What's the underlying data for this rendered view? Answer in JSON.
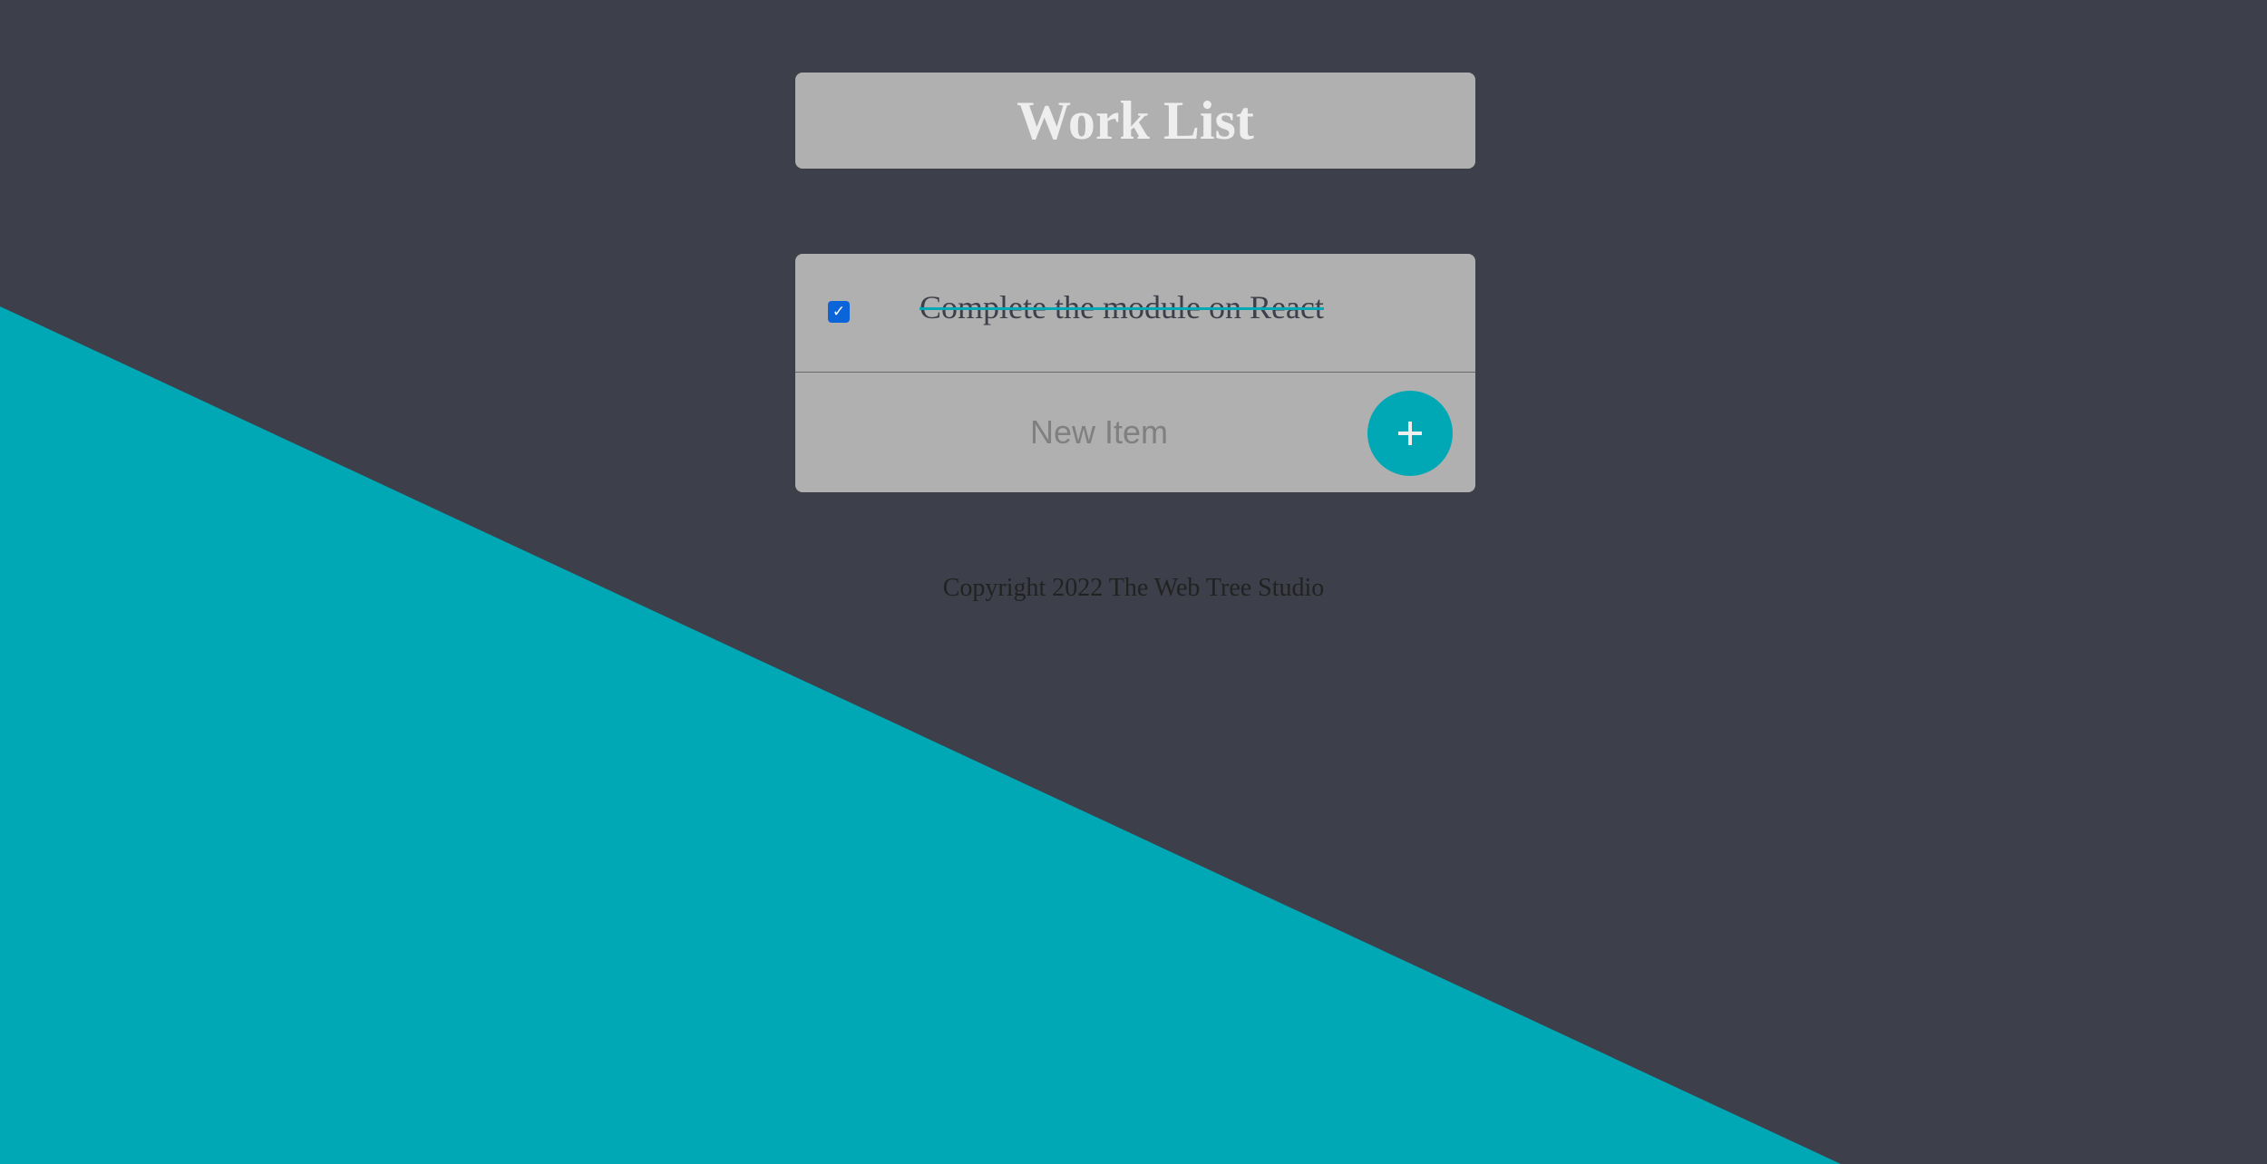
{
  "header": {
    "title": "Work List"
  },
  "todo": {
    "items": [
      {
        "text": "Complete the module on React",
        "checked": true
      }
    ],
    "new_item": {
      "placeholder": "New Item",
      "value": ""
    },
    "add_button_label": "+"
  },
  "footer": {
    "copyright": "Copyright 2022 The Web Tree Studio"
  },
  "colors": {
    "background": "#3d404a",
    "accent": "#00a8b5",
    "card": "#b0b0b0",
    "checkbox": "#0b65d8",
    "heading_text": "#eeeeee"
  },
  "icons": {
    "add": "plus-icon",
    "checked": "checkmark-icon"
  }
}
